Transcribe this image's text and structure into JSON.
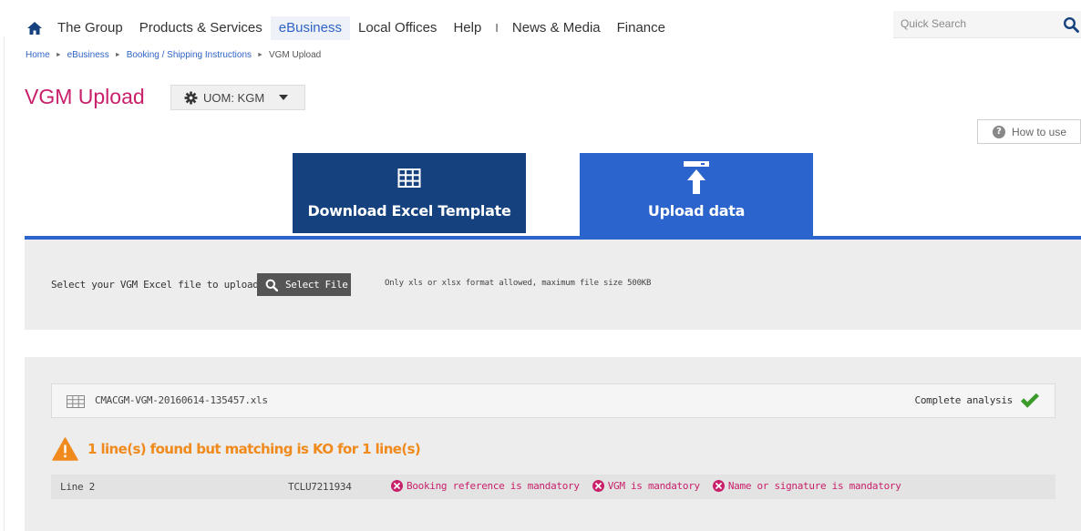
{
  "nav": {
    "items": [
      "The Group",
      "Products & Services",
      "eBusiness",
      "Local Offices",
      "Help",
      "News & Media",
      "Finance"
    ],
    "active_index": 2,
    "separator": "I",
    "search_placeholder": "Quick Search"
  },
  "breadcrumb": {
    "items": [
      "Home",
      "eBusiness",
      "Booking / Shipping Instructions"
    ],
    "current": "VGM Upload"
  },
  "page": {
    "title": "VGM Upload",
    "uom_label": "UOM: KGM",
    "how_to_label": "How to use"
  },
  "steps": {
    "download_label": "Download Excel Template",
    "upload_label": "Upload data"
  },
  "upload": {
    "label": "Select your VGM Excel file to upload",
    "button_label": "Select File",
    "hint": "Only xls or xlsx format allowed, maximum file size 500KB"
  },
  "result": {
    "file_name": "CMACGM-VGM-20160614-135457.xls",
    "status": "Complete analysis",
    "warning": "1 line(s) found but matching is KO for 1 line(s)",
    "rows": [
      {
        "line": "Line 2",
        "container": "TCLU7211934",
        "errors": [
          "Booking reference is mandatory",
          "VGM is mandatory",
          "Name or signature is mandatory"
        ]
      }
    ]
  },
  "colors": {
    "brand_pink": "#c8206a",
    "nav_blue": "#2f63c7",
    "step_dark_blue": "#15427e",
    "step_blue": "#2a64cc",
    "warning_orange": "#f08a1c",
    "success_green": "#3a9a2a"
  }
}
